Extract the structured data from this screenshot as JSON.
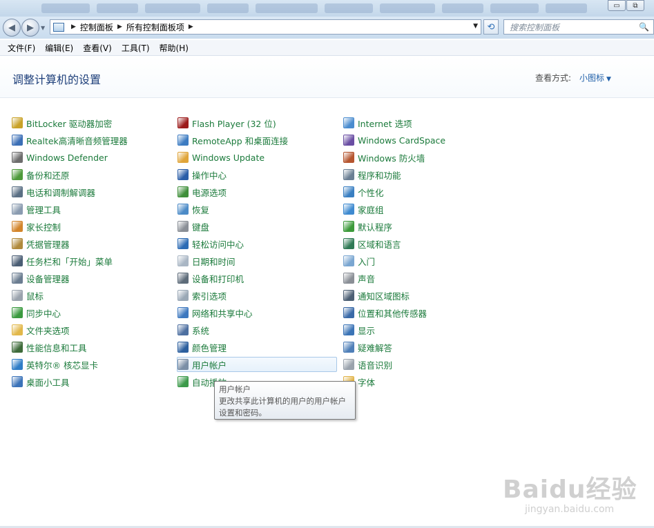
{
  "window": {
    "min_label": "▭",
    "max_label": "⧉"
  },
  "nav": {
    "back_icon": "◀",
    "forward_icon": "▶",
    "dropdown_icon": "▼",
    "breadcrumb": [
      "控制面板",
      "所有控制面板项"
    ],
    "crumb_sep": "▶",
    "refresh_icon": "⟲",
    "search_placeholder": "搜索控制面板",
    "search_icon": "🔍"
  },
  "menubar": [
    "文件(F)",
    "编辑(E)",
    "查看(V)",
    "工具(T)",
    "帮助(H)"
  ],
  "header": {
    "title": "调整计算机的设置",
    "view_by_label": "查看方式:",
    "view_by_value": "小图标",
    "view_caret": "▼"
  },
  "columns": [
    [
      {
        "label": "BitLocker 驱动器加密",
        "icon": "bitlocker-icon",
        "color": "#c9a227"
      },
      {
        "label": "Realtek高清晰音频管理器",
        "icon": "realtek-audio-icon",
        "color": "#3b6fb6"
      },
      {
        "label": "Windows Defender",
        "icon": "defender-icon",
        "color": "#6d6d6d"
      },
      {
        "label": "备份和还原",
        "icon": "backup-icon",
        "color": "#4e9a3a"
      },
      {
        "label": "电话和调制解调器",
        "icon": "phone-modem-icon",
        "color": "#5a6f84"
      },
      {
        "label": "管理工具",
        "icon": "admin-tools-icon",
        "color": "#8a9bb0"
      },
      {
        "label": "家长控制",
        "icon": "parental-control-icon",
        "color": "#d3852b"
      },
      {
        "label": "凭据管理器",
        "icon": "credential-manager-icon",
        "color": "#b08a3c"
      },
      {
        "label": "任务栏和「开始」菜单",
        "icon": "taskbar-icon",
        "color": "#4a5d74"
      },
      {
        "label": "设备管理器",
        "icon": "device-manager-icon",
        "color": "#6b7d91"
      },
      {
        "label": "鼠标",
        "icon": "mouse-icon",
        "color": "#9aa3ad"
      },
      {
        "label": "同步中心",
        "icon": "sync-center-icon",
        "color": "#3a9a3f"
      },
      {
        "label": "文件夹选项",
        "icon": "folder-options-icon",
        "color": "#e2b84a"
      },
      {
        "label": "性能信息和工具",
        "icon": "performance-icon",
        "color": "#3e6b3a"
      },
      {
        "label": "英特尔® 核芯显卡",
        "icon": "intel-graphics-icon",
        "color": "#2f7dc7"
      },
      {
        "label": "桌面小工具",
        "icon": "gadgets-icon",
        "color": "#3b73b9"
      }
    ],
    [
      {
        "label": "Flash Player (32 位)",
        "icon": "flash-player-icon",
        "color": "#9c1b1b"
      },
      {
        "label": "RemoteApp 和桌面连接",
        "icon": "remoteapp-icon",
        "color": "#3d7cc2"
      },
      {
        "label": "Windows Update",
        "icon": "windows-update-icon",
        "color": "#e0a53a"
      },
      {
        "label": "操作中心",
        "icon": "action-center-icon",
        "color": "#2b5ea8"
      },
      {
        "label": "电源选项",
        "icon": "power-options-icon",
        "color": "#3f8f3a"
      },
      {
        "label": "恢复",
        "icon": "recovery-icon",
        "color": "#4c8bc7"
      },
      {
        "label": "键盘",
        "icon": "keyboard-icon",
        "color": "#8a8f96"
      },
      {
        "label": "轻松访问中心",
        "icon": "ease-of-access-icon",
        "color": "#2d6cb5"
      },
      {
        "label": "日期和时间",
        "icon": "date-time-icon",
        "color": "#a9b6c4"
      },
      {
        "label": "设备和打印机",
        "icon": "devices-printers-icon",
        "color": "#5e6c7a"
      },
      {
        "label": "索引选项",
        "icon": "indexing-icon",
        "color": "#9aa8b6"
      },
      {
        "label": "网络和共享中心",
        "icon": "network-sharing-icon",
        "color": "#3d78bf"
      },
      {
        "label": "系统",
        "icon": "system-icon",
        "color": "#4d6fa0"
      },
      {
        "label": "颜色管理",
        "icon": "color-management-icon",
        "color": "#2c5f9e"
      },
      {
        "label": "用户帐户",
        "icon": "user-accounts-icon",
        "color": "#7b8fa6"
      },
      {
        "label": "自动播放",
        "icon": "autoplay-icon",
        "color": "#3c9a4a"
      }
    ],
    [
      {
        "label": "Internet 选项",
        "icon": "internet-options-icon",
        "color": "#4a8ccf"
      },
      {
        "label": "Windows CardSpace",
        "icon": "cardspace-icon",
        "color": "#6a4ea3"
      },
      {
        "label": "Windows 防火墙",
        "icon": "firewall-icon",
        "color": "#b5552f"
      },
      {
        "label": "程序和功能",
        "icon": "programs-features-icon",
        "color": "#6b7f94"
      },
      {
        "label": "个性化",
        "icon": "personalization-icon",
        "color": "#3a7fc2"
      },
      {
        "label": "家庭组",
        "icon": "homegroup-icon",
        "color": "#3e8ad0"
      },
      {
        "label": "默认程序",
        "icon": "default-programs-icon",
        "color": "#3c9a3a"
      },
      {
        "label": "区域和语言",
        "icon": "region-language-icon",
        "color": "#2f7a55"
      },
      {
        "label": "入门",
        "icon": "getting-started-icon",
        "color": "#7aa6d1"
      },
      {
        "label": "声音",
        "icon": "sound-icon",
        "color": "#8a8f96"
      },
      {
        "label": "通知区域图标",
        "icon": "notification-area-icon",
        "color": "#4c5f74"
      },
      {
        "label": "位置和其他传感器",
        "icon": "location-sensors-icon",
        "color": "#3a6aa8"
      },
      {
        "label": "显示",
        "icon": "display-icon",
        "color": "#3b74b6"
      },
      {
        "label": "疑难解答",
        "icon": "troubleshooting-icon",
        "color": "#4f7fb8"
      },
      {
        "label": "语音识别",
        "icon": "speech-recognition-icon",
        "color": "#9aa3ad"
      },
      {
        "label": "字体",
        "icon": "fonts-icon",
        "color": "#e0b245"
      }
    ]
  ],
  "tooltip": {
    "title": "用户帐户",
    "text": "更改共享此计算机的用户的用户帐户设置和密码。"
  },
  "watermark": {
    "brand": "Baidu经验",
    "site": "jingyan.baidu.com"
  }
}
